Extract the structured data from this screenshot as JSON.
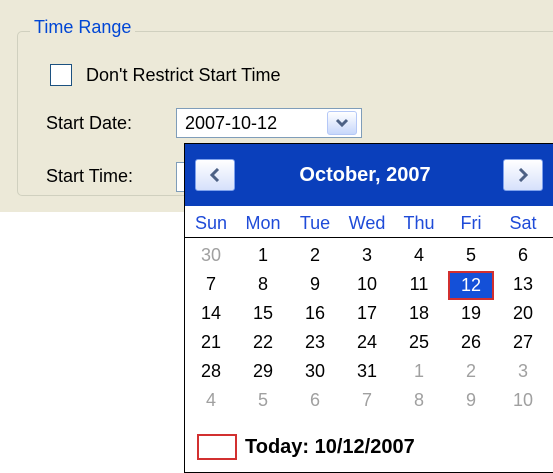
{
  "group": {
    "title": "Time Range"
  },
  "restrict_checkbox": {
    "label": "Don't Restrict Start Time",
    "checked": false
  },
  "start_date": {
    "label": "Start Date:",
    "value": "2007-10-12"
  },
  "start_time": {
    "label": "Start Time:"
  },
  "calendar": {
    "month_title": "October, 2007",
    "prev_glyph": "<",
    "next_glyph": ">",
    "weekdays": [
      "Sun",
      "Mon",
      "Tue",
      "Wed",
      "Thu",
      "Fri",
      "Sat"
    ],
    "weeks": [
      [
        {
          "d": "30",
          "other": true
        },
        {
          "d": "1"
        },
        {
          "d": "2"
        },
        {
          "d": "3"
        },
        {
          "d": "4"
        },
        {
          "d": "5"
        },
        {
          "d": "6"
        }
      ],
      [
        {
          "d": "7"
        },
        {
          "d": "8"
        },
        {
          "d": "9"
        },
        {
          "d": "10"
        },
        {
          "d": "11"
        },
        {
          "d": "12",
          "selected": true
        },
        {
          "d": "13"
        }
      ],
      [
        {
          "d": "14"
        },
        {
          "d": "15"
        },
        {
          "d": "16"
        },
        {
          "d": "17"
        },
        {
          "d": "18"
        },
        {
          "d": "19"
        },
        {
          "d": "20"
        }
      ],
      [
        {
          "d": "21"
        },
        {
          "d": "22"
        },
        {
          "d": "23"
        },
        {
          "d": "24"
        },
        {
          "d": "25"
        },
        {
          "d": "26"
        },
        {
          "d": "27"
        }
      ],
      [
        {
          "d": "28"
        },
        {
          "d": "29"
        },
        {
          "d": "30"
        },
        {
          "d": "31"
        },
        {
          "d": "1",
          "other": true
        },
        {
          "d": "2",
          "other": true
        },
        {
          "d": "3",
          "other": true
        }
      ],
      [
        {
          "d": "4",
          "other": true
        },
        {
          "d": "5",
          "other": true
        },
        {
          "d": "6",
          "other": true
        },
        {
          "d": "7",
          "other": true
        },
        {
          "d": "8",
          "other": true
        },
        {
          "d": "9",
          "other": true
        },
        {
          "d": "10",
          "other": true
        }
      ]
    ],
    "today_label": "Today: 10/12/2007"
  },
  "colors": {
    "header": "#0a3fbb",
    "selected": "#1450d8",
    "today_border": "#d23030",
    "weekday_text": "#1f4bd8",
    "legend_text": "#0046d5"
  },
  "icons": {
    "combo_dropdown": "chevron-down-icon",
    "prev_month": "chevron-left-icon",
    "next_month": "chevron-right-icon"
  }
}
